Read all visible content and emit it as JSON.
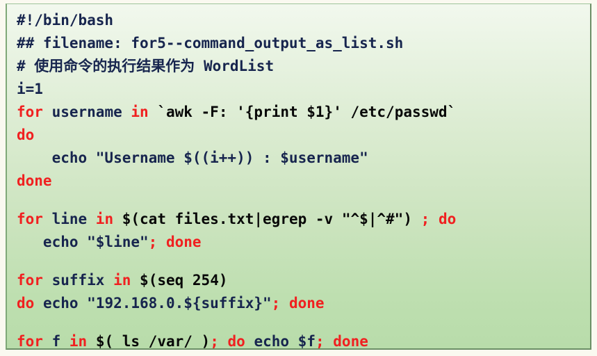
{
  "document": {
    "kind": "shell-script-code-listing",
    "language": "bash",
    "colors": {
      "keyword": "#f02020",
      "command": "#17254e",
      "comment": "#17254e",
      "plain": "#080808",
      "background_top": "#f2f8ee",
      "background_bottom": "#b8dcaa",
      "border": "#6b8f66",
      "page": "#faf9f0"
    },
    "lines": [
      {
        "id": "line-shebang",
        "tokens": [
          {
            "text": "#!/bin/bash",
            "role": "cmd"
          }
        ]
      },
      {
        "id": "line-filename-comment",
        "tokens": [
          {
            "text": "## filename: for5--command_output_as_list.sh",
            "role": "cmt"
          }
        ]
      },
      {
        "id": "line-chinese-comment",
        "tokens": [
          {
            "text": "# ",
            "role": "cmt"
          },
          {
            "text": "使用命令的执行结果作为",
            "role": "cmt-han"
          },
          {
            "text": " WordList",
            "role": "cmt"
          }
        ]
      },
      {
        "id": "line-i-assign",
        "tokens": [
          {
            "text": "i=1",
            "role": "cmd"
          }
        ]
      },
      {
        "id": "line-for-username",
        "tokens": [
          {
            "text": "for",
            "role": "kw"
          },
          {
            "text": " username ",
            "role": "cmd"
          },
          {
            "text": "in",
            "role": "kw"
          },
          {
            "text": " ",
            "role": "cmd"
          },
          {
            "text": "`awk -F: '{print $1}' /etc/passwd`",
            "role": "plain"
          }
        ]
      },
      {
        "id": "line-do-1",
        "tokens": [
          {
            "text": "do",
            "role": "kw"
          }
        ]
      },
      {
        "id": "line-echo-username",
        "tokens": [
          {
            "text": "    echo \"Username $((i++)) : $username\"",
            "role": "cmd"
          }
        ]
      },
      {
        "id": "line-done-1",
        "tokens": [
          {
            "text": "done",
            "role": "kw"
          }
        ]
      },
      {
        "id": "line-blank-1",
        "blank": true,
        "tokens": []
      },
      {
        "id": "line-for-line",
        "tokens": [
          {
            "text": "for",
            "role": "kw"
          },
          {
            "text": " line ",
            "role": "cmd"
          },
          {
            "text": "in",
            "role": "kw"
          },
          {
            "text": " ",
            "role": "cmd"
          },
          {
            "text": "$(cat files.txt|egrep -v \"^$|^#\")",
            "role": "plain"
          },
          {
            "text": " ",
            "role": "cmd"
          },
          {
            "text": ";",
            "role": "kw"
          },
          {
            "text": " ",
            "role": "cmd"
          },
          {
            "text": "do",
            "role": "kw"
          }
        ]
      },
      {
        "id": "line-echo-line",
        "tokens": [
          {
            "text": "   echo \"$line\"",
            "role": "cmd"
          },
          {
            "text": ";",
            "role": "kw"
          },
          {
            "text": " ",
            "role": "cmd"
          },
          {
            "text": "done",
            "role": "kw"
          }
        ]
      },
      {
        "id": "line-blank-2",
        "blank": true,
        "tokens": []
      },
      {
        "id": "line-for-suffix",
        "tokens": [
          {
            "text": "for",
            "role": "kw"
          },
          {
            "text": " suffix ",
            "role": "cmd"
          },
          {
            "text": "in",
            "role": "kw"
          },
          {
            "text": " ",
            "role": "cmd"
          },
          {
            "text": "$(seq 254)",
            "role": "plain"
          }
        ]
      },
      {
        "id": "line-do-echo-suffix",
        "tokens": [
          {
            "text": "do",
            "role": "kw"
          },
          {
            "text": " echo \"192.168.0.${suffix}\"",
            "role": "cmd"
          },
          {
            "text": ";",
            "role": "kw"
          },
          {
            "text": " ",
            "role": "cmd"
          },
          {
            "text": "done",
            "role": "kw"
          }
        ]
      },
      {
        "id": "line-blank-3",
        "blank": true,
        "tokens": []
      },
      {
        "id": "line-for-f",
        "tokens": [
          {
            "text": "for",
            "role": "kw"
          },
          {
            "text": " f ",
            "role": "cmd"
          },
          {
            "text": "in",
            "role": "kw"
          },
          {
            "text": " ",
            "role": "cmd"
          },
          {
            "text": "$( ls /var/ )",
            "role": "plain"
          },
          {
            "text": ";",
            "role": "kw"
          },
          {
            "text": " ",
            "role": "cmd"
          },
          {
            "text": "do",
            "role": "kw"
          },
          {
            "text": " echo $f",
            "role": "cmd"
          },
          {
            "text": ";",
            "role": "kw"
          },
          {
            "text": " ",
            "role": "cmd"
          },
          {
            "text": "done",
            "role": "kw"
          }
        ]
      }
    ]
  }
}
